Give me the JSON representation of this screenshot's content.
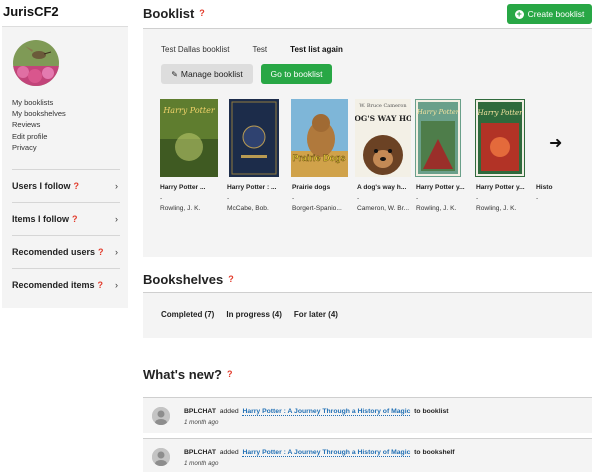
{
  "user": {
    "name": "JurisCF2"
  },
  "sidebar": {
    "links": [
      "My booklists",
      "My bookshelves",
      "Reviews",
      "Edit profile",
      "Privacy"
    ],
    "sections": [
      {
        "label": "Users I follow",
        "help": "?"
      },
      {
        "label": "Items I follow",
        "help": "?"
      },
      {
        "label": "Recomended users",
        "help": "?"
      },
      {
        "label": "Recomended items",
        "help": "?"
      }
    ]
  },
  "booklist": {
    "heading": "Booklist",
    "help": "?",
    "create_label": "Create booklist",
    "tabs": [
      "Test Dallas booklist",
      "Test",
      "Test list again"
    ],
    "active_tab": "Test list again",
    "manage_label": "Manage booklist",
    "goto_label": "Go to booklist",
    "books": [
      {
        "title": "Harry Potter ...",
        "dash": "-",
        "author": "Rowling, J. K."
      },
      {
        "title": "Harry Potter : ...",
        "dash": "-",
        "author": "McCabe, Bob."
      },
      {
        "title": "Prairie dogs",
        "dash": "-",
        "author": "Borgert-Spanio..."
      },
      {
        "title": "A dog's way h...",
        "dash": "-",
        "author": "Cameron, W. Br..."
      },
      {
        "title": "Harry Potter y...",
        "dash": "-",
        "author": "Rowling, J. K."
      },
      {
        "title": "Harry Potter y...",
        "dash": "-",
        "author": "Rowling, J. K."
      },
      {
        "title": "Histo",
        "dash": "-",
        "author": ""
      }
    ],
    "cover_texts": {
      "hp_logo": "Harry Potter",
      "prairie": "Prairie Dogs",
      "dog_author": "W. Bruce Cameron",
      "dog_title": "A DOG'S WAY HOME"
    }
  },
  "bookshelves": {
    "heading": "Bookshelves",
    "help": "?",
    "items": [
      "Completed (7)",
      "In progress (4)",
      "For later (4)"
    ]
  },
  "whats_new": {
    "heading": "What's new?",
    "help": "?",
    "entries": [
      {
        "user": "BPLCHAT",
        "verb": "added",
        "link": "Harry Potter : A Journey Through a History of Magic",
        "suffix": "to booklist",
        "ago": "1 month ago"
      },
      {
        "user": "BPLCHAT",
        "verb": "added",
        "link": "Harry Potter : A Journey Through a History of Magic",
        "suffix": "to bookshelf",
        "ago": "1 month ago"
      }
    ]
  },
  "colors": {
    "accent_green": "#28a745",
    "help_red": "#e23a2a",
    "link_blue": "#1f6fb5",
    "panel_bg": "#f4f4f4"
  }
}
